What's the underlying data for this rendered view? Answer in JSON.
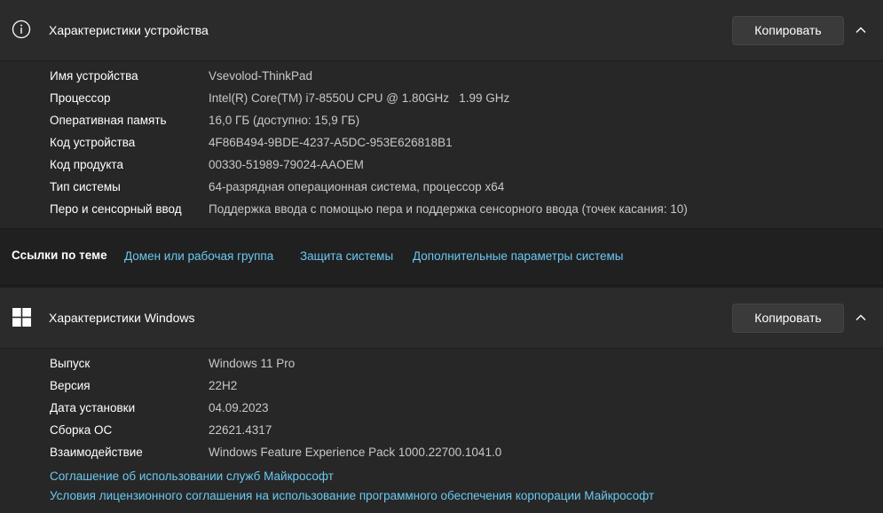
{
  "device_card": {
    "title": "Характеристики устройства",
    "copy_label": "Копировать",
    "rows": [
      {
        "label": "Имя устройства",
        "value": "Vsevolod-ThinkPad"
      },
      {
        "label": "Процессор",
        "value": "Intel(R) Core(TM) i7-8550U CPU @ 1.80GHz   1.99 GHz"
      },
      {
        "label": "Оперативная память",
        "value": "16,0 ГБ (доступно: 15,9 ГБ)"
      },
      {
        "label": "Код устройства",
        "value": "4F86B494-9BDE-4237-A5DC-953E626818B1"
      },
      {
        "label": "Код продукта",
        "value": "00330-51989-79024-AAOEM"
      },
      {
        "label": "Тип системы",
        "value": "64-разрядная операционная система, процессор x64"
      },
      {
        "label": "Перо и сенсорный ввод",
        "value": "Поддержка ввода с помощью пера и поддержка сенсорного ввода (точек касания: 10)"
      }
    ]
  },
  "related_links": {
    "title": "Ссылки по теме",
    "links": [
      "Домен или рабочая группа",
      "Защита системы",
      "Дополнительные параметры системы"
    ]
  },
  "windows_card": {
    "title": "Характеристики Windows",
    "copy_label": "Копировать",
    "rows": [
      {
        "label": "Выпуск",
        "value": "Windows 11 Pro"
      },
      {
        "label": "Версия",
        "value": "22H2"
      },
      {
        "label": "Дата установки",
        "value": "04.09.2023"
      },
      {
        "label": "Сборка ОС",
        "value": "22621.4317"
      },
      {
        "label": "Взаимодействие",
        "value": "Windows Feature Experience Pack 1000.22700.1041.0"
      }
    ],
    "links": [
      "Соглашение об использовании служб Майкрософт",
      "Условия лицензионного соглашения на использование программного обеспечения корпорации Майкрософт"
    ]
  },
  "colors": {
    "link": "#6cc8f0",
    "header_bg": "#2b2b2b",
    "body_bg": "#272727",
    "page_bg": "#1c1c1c"
  },
  "icons": {
    "device_header": "info-icon",
    "windows_header": "windows-logo-icon",
    "collapse": "chevron-up-icon"
  }
}
